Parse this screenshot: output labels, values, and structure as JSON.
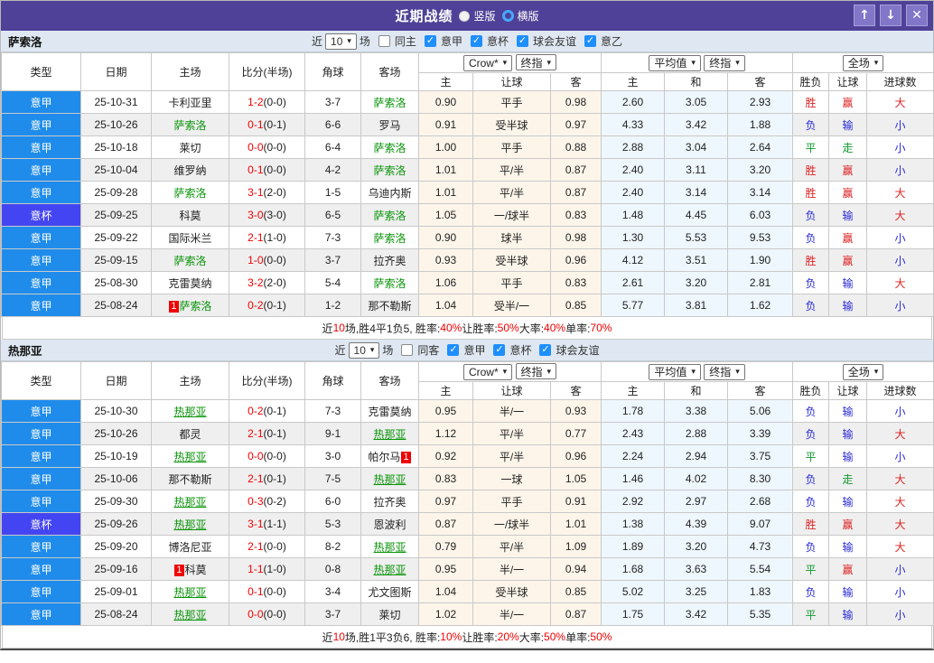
{
  "icons": {
    "chevron_down": "▾",
    "arrow_up": "↑",
    "arrow_down": "↓",
    "close": "✕",
    "check": "✓"
  },
  "colors": {
    "titlebar_bg": "#4e4197",
    "league_blue": "#1f8ceb",
    "cup_purple": "#4445f2",
    "team_highlight_green": "#099409",
    "score_red": "#f00000",
    "win_red": "#dd2222",
    "lose_blue": "#2a2ad8",
    "draw_green": "#0f9a30",
    "crow_col_bg": "#fdf5ea",
    "avg_col_bg": "#eef7fd"
  },
  "titlebar": {
    "title": "近期战绩",
    "radios": [
      {
        "label": "竖版",
        "selected": true
      },
      {
        "label": "横版",
        "selected": false
      }
    ]
  },
  "legend": {
    "league": "意甲",
    "cup": "意杯"
  },
  "table": {
    "main_cols": [
      "类型",
      "日期",
      "主场",
      "比分(半场)",
      "角球",
      "客场"
    ],
    "selects": [
      "Crow*",
      "终指",
      "平均值",
      "终指",
      "全场"
    ],
    "sub_cols": [
      "主",
      "让球",
      "客",
      "主",
      "和",
      "客",
      "胜负",
      "让球",
      "进球数"
    ]
  },
  "sections": [
    {
      "team": "萨索洛",
      "team_underline": false,
      "filters": {
        "near": "近",
        "count": "10",
        "games": "场",
        "same": "同主",
        "same_checked": false,
        "leagues": [
          {
            "label": "意甲",
            "checked": true
          },
          {
            "label": "意杯",
            "checked": true
          },
          {
            "label": "球会友谊",
            "checked": true
          },
          {
            "label": "意乙",
            "checked": true
          }
        ]
      },
      "rows": [
        {
          "comp": "意甲",
          "date": "25-10-31",
          "home": {
            "name": "卡利亚里",
            "hl": false
          },
          "score": "1-2",
          "half": "(0-0)",
          "corner": "3-7",
          "away": {
            "name": "萨索洛",
            "hl": true
          },
          "crow": [
            "0.90",
            "平手",
            "0.98"
          ],
          "avg": [
            "2.60",
            "3.05",
            "2.93"
          ],
          "res": [
            "胜",
            "赢",
            "大"
          ]
        },
        {
          "comp": "意甲",
          "date": "25-10-26",
          "home": {
            "name": "萨索洛",
            "hl": true
          },
          "score": "0-1",
          "half": "(0-1)",
          "corner": "6-6",
          "away": {
            "name": "罗马",
            "hl": false
          },
          "crow": [
            "0.91",
            "受半球",
            "0.97"
          ],
          "avg": [
            "4.33",
            "3.42",
            "1.88"
          ],
          "res": [
            "负",
            "输",
            "小"
          ]
        },
        {
          "comp": "意甲",
          "date": "25-10-18",
          "home": {
            "name": "莱切",
            "hl": false
          },
          "score": "0-0",
          "half": "(0-0)",
          "corner": "6-4",
          "away": {
            "name": "萨索洛",
            "hl": true
          },
          "crow": [
            "1.00",
            "平手",
            "0.88"
          ],
          "avg": [
            "2.88",
            "3.04",
            "2.64"
          ],
          "res": [
            "平",
            "走",
            "小"
          ]
        },
        {
          "comp": "意甲",
          "date": "25-10-04",
          "home": {
            "name": "维罗纳",
            "hl": false
          },
          "score": "0-1",
          "half": "(0-0)",
          "corner": "4-2",
          "away": {
            "name": "萨索洛",
            "hl": true
          },
          "crow": [
            "1.01",
            "平/半",
            "0.87"
          ],
          "avg": [
            "2.40",
            "3.11",
            "3.20"
          ],
          "res": [
            "胜",
            "赢",
            "小"
          ]
        },
        {
          "comp": "意甲",
          "date": "25-09-28",
          "home": {
            "name": "萨索洛",
            "hl": true
          },
          "score": "3-1",
          "half": "(2-0)",
          "corner": "1-5",
          "away": {
            "name": "乌迪内斯",
            "hl": false
          },
          "crow": [
            "1.01",
            "平/半",
            "0.87"
          ],
          "avg": [
            "2.40",
            "3.14",
            "3.14"
          ],
          "res": [
            "胜",
            "赢",
            "大"
          ]
        },
        {
          "comp": "意杯",
          "date": "25-09-25",
          "home": {
            "name": "科莫",
            "hl": false
          },
          "score": "3-0",
          "half": "(3-0)",
          "corner": "6-5",
          "away": {
            "name": "萨索洛",
            "hl": true
          },
          "crow": [
            "1.05",
            "一/球半",
            "0.83"
          ],
          "avg": [
            "1.48",
            "4.45",
            "6.03"
          ],
          "res": [
            "负",
            "输",
            "大"
          ]
        },
        {
          "comp": "意甲",
          "date": "25-09-22",
          "home": {
            "name": "国际米兰",
            "hl": false
          },
          "score": "2-1",
          "half": "(1-0)",
          "corner": "7-3",
          "away": {
            "name": "萨索洛",
            "hl": true
          },
          "crow": [
            "0.90",
            "球半",
            "0.98"
          ],
          "avg": [
            "1.30",
            "5.53",
            "9.53"
          ],
          "res": [
            "负",
            "赢",
            "小"
          ]
        },
        {
          "comp": "意甲",
          "date": "25-09-15",
          "home": {
            "name": "萨索洛",
            "hl": true
          },
          "score": "1-0",
          "half": "(0-0)",
          "corner": "3-7",
          "away": {
            "name": "拉齐奥",
            "hl": false
          },
          "crow": [
            "0.93",
            "受半球",
            "0.96"
          ],
          "avg": [
            "4.12",
            "3.51",
            "1.90"
          ],
          "res": [
            "胜",
            "赢",
            "小"
          ]
        },
        {
          "comp": "意甲",
          "date": "25-08-30",
          "home": {
            "name": "克雷莫纳",
            "hl": false
          },
          "score": "3-2",
          "half": "(2-0)",
          "corner": "5-4",
          "away": {
            "name": "萨索洛",
            "hl": true
          },
          "crow": [
            "1.06",
            "平手",
            "0.83"
          ],
          "avg": [
            "2.61",
            "3.20",
            "2.81"
          ],
          "res": [
            "负",
            "输",
            "大"
          ]
        },
        {
          "comp": "意甲",
          "date": "25-08-24",
          "home": {
            "name": "萨索洛",
            "hl": true,
            "badge": "1",
            "badge_pos": "before"
          },
          "score": "0-2",
          "half": "(0-1)",
          "corner": "1-2",
          "away": {
            "name": "那不勒斯",
            "hl": false
          },
          "crow": [
            "1.04",
            "受半/一",
            "0.85"
          ],
          "avg": [
            "5.77",
            "3.81",
            "1.62"
          ],
          "res": [
            "负",
            "输",
            "小"
          ]
        }
      ],
      "summary": [
        [
          "近",
          "k"
        ],
        [
          "10",
          "r"
        ],
        [
          "场,胜4平1负5, 胜率:",
          "k"
        ],
        [
          "40%",
          "r"
        ],
        [
          " 让胜率:",
          "k"
        ],
        [
          "50%",
          "r"
        ],
        [
          " 大率:",
          "k"
        ],
        [
          "40%",
          "r"
        ],
        [
          " 单率:",
          "k"
        ],
        [
          "70%",
          "r"
        ]
      ]
    },
    {
      "team": "热那亚",
      "team_underline": true,
      "filters": {
        "near": "近",
        "count": "10",
        "games": "场",
        "same": "同客",
        "same_checked": false,
        "leagues": [
          {
            "label": "意甲",
            "checked": true
          },
          {
            "label": "意杯",
            "checked": true
          },
          {
            "label": "球会友谊",
            "checked": true
          }
        ]
      },
      "rows": [
        {
          "comp": "意甲",
          "date": "25-10-30",
          "home": {
            "name": "热那亚",
            "hl": true
          },
          "score": "0-2",
          "half": "(0-1)",
          "corner": "7-3",
          "away": {
            "name": "克雷莫纳",
            "hl": false
          },
          "crow": [
            "0.95",
            "半/一",
            "0.93"
          ],
          "avg": [
            "1.78",
            "3.38",
            "5.06"
          ],
          "res": [
            "负",
            "输",
            "小"
          ]
        },
        {
          "comp": "意甲",
          "date": "25-10-26",
          "home": {
            "name": "都灵",
            "hl": false
          },
          "score": "2-1",
          "half": "(0-1)",
          "corner": "9-1",
          "away": {
            "name": "热那亚",
            "hl": true
          },
          "crow": [
            "1.12",
            "平/半",
            "0.77"
          ],
          "avg": [
            "2.43",
            "2.88",
            "3.39"
          ],
          "res": [
            "负",
            "输",
            "大"
          ]
        },
        {
          "comp": "意甲",
          "date": "25-10-19",
          "home": {
            "name": "热那亚",
            "hl": true
          },
          "score": "0-0",
          "half": "(0-0)",
          "corner": "3-0",
          "away": {
            "name": "帕尔马",
            "hl": false,
            "badge": "1",
            "badge_pos": "after"
          },
          "crow": [
            "0.92",
            "平/半",
            "0.96"
          ],
          "avg": [
            "2.24",
            "2.94",
            "3.75"
          ],
          "res": [
            "平",
            "输",
            "小"
          ]
        },
        {
          "comp": "意甲",
          "date": "25-10-06",
          "home": {
            "name": "那不勒斯",
            "hl": false
          },
          "score": "2-1",
          "half": "(0-1)",
          "corner": "7-5",
          "away": {
            "name": "热那亚",
            "hl": true
          },
          "crow": [
            "0.83",
            "一球",
            "1.05"
          ],
          "avg": [
            "1.46",
            "4.02",
            "8.30"
          ],
          "res": [
            "负",
            "走",
            "大"
          ]
        },
        {
          "comp": "意甲",
          "date": "25-09-30",
          "home": {
            "name": "热那亚",
            "hl": true
          },
          "score": "0-3",
          "half": "(0-2)",
          "corner": "6-0",
          "away": {
            "name": "拉齐奥",
            "hl": false
          },
          "crow": [
            "0.97",
            "平手",
            "0.91"
          ],
          "avg": [
            "2.92",
            "2.97",
            "2.68"
          ],
          "res": [
            "负",
            "输",
            "大"
          ]
        },
        {
          "comp": "意杯",
          "date": "25-09-26",
          "home": {
            "name": "热那亚",
            "hl": true
          },
          "score": "3-1",
          "half": "(1-1)",
          "corner": "5-3",
          "away": {
            "name": "恩波利",
            "hl": false
          },
          "crow": [
            "0.87",
            "一/球半",
            "1.01"
          ],
          "avg": [
            "1.38",
            "4.39",
            "9.07"
          ],
          "res": [
            "胜",
            "赢",
            "大"
          ]
        },
        {
          "comp": "意甲",
          "date": "25-09-20",
          "home": {
            "name": "博洛尼亚",
            "hl": false
          },
          "score": "2-1",
          "half": "(0-0)",
          "corner": "8-2",
          "away": {
            "name": "热那亚",
            "hl": true
          },
          "crow": [
            "0.79",
            "平/半",
            "1.09"
          ],
          "avg": [
            "1.89",
            "3.20",
            "4.73"
          ],
          "res": [
            "负",
            "输",
            "大"
          ]
        },
        {
          "comp": "意甲",
          "date": "25-09-16",
          "home": {
            "name": "科莫",
            "hl": false,
            "badge": "1",
            "badge_pos": "before"
          },
          "score": "1-1",
          "half": "(1-0)",
          "corner": "0-8",
          "away": {
            "name": "热那亚",
            "hl": true
          },
          "crow": [
            "0.95",
            "半/一",
            "0.94"
          ],
          "avg": [
            "1.68",
            "3.63",
            "5.54"
          ],
          "res": [
            "平",
            "赢",
            "小"
          ]
        },
        {
          "comp": "意甲",
          "date": "25-09-01",
          "home": {
            "name": "热那亚",
            "hl": true
          },
          "score": "0-1",
          "half": "(0-0)",
          "corner": "3-4",
          "away": {
            "name": "尤文图斯",
            "hl": false
          },
          "crow": [
            "1.04",
            "受半球",
            "0.85"
          ],
          "avg": [
            "5.02",
            "3.25",
            "1.83"
          ],
          "res": [
            "负",
            "输",
            "小"
          ]
        },
        {
          "comp": "意甲",
          "date": "25-08-24",
          "home": {
            "name": "热那亚",
            "hl": true
          },
          "score": "0-0",
          "half": "(0-0)",
          "corner": "3-7",
          "away": {
            "name": "莱切",
            "hl": false
          },
          "crow": [
            "1.02",
            "半/一",
            "0.87"
          ],
          "avg": [
            "1.75",
            "3.42",
            "5.35"
          ],
          "res": [
            "平",
            "输",
            "小"
          ]
        }
      ],
      "summary": [
        [
          "近",
          "k"
        ],
        [
          "10",
          "r"
        ],
        [
          "场,胜1平3负6, 胜率:",
          "k"
        ],
        [
          "10%",
          "r"
        ],
        [
          " 让胜率:",
          "k"
        ],
        [
          "20%",
          "r"
        ],
        [
          " 大率:",
          "k"
        ],
        [
          "50%",
          "r"
        ],
        [
          " 单率:",
          "k"
        ],
        [
          "50%",
          "r"
        ]
      ]
    }
  ]
}
